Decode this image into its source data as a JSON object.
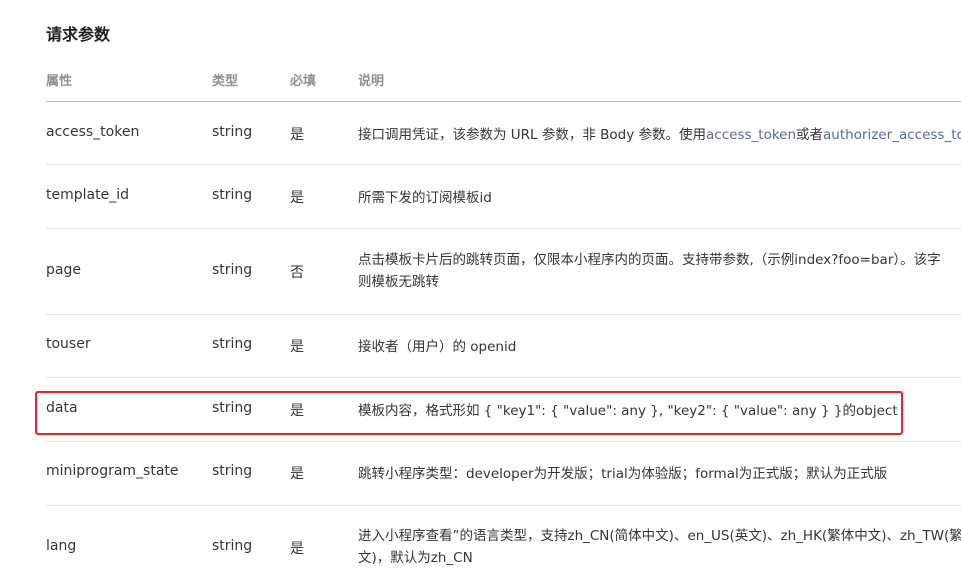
{
  "section_title": "请求参数",
  "table": {
    "headers": {
      "name": "属性",
      "type": "类型",
      "required": "必填",
      "desc": "说明"
    },
    "rows": [
      {
        "name": "access_token",
        "type": "string",
        "required": "是",
        "desc_parts": [
          "接口调用凭证，该参数为 URL 参数，非 Body 参数。使用",
          "access_token",
          "或者",
          "authorizer_access_to"
        ]
      },
      {
        "name": "template_id",
        "type": "string",
        "required": "是",
        "desc": "所需下发的订阅模板id"
      },
      {
        "name": "page",
        "type": "string",
        "required": "否",
        "desc_lines": [
          "点击模板卡片后的跳转页面，仅限本小程序内的页面。支持带参数,（示例index?foo=bar）。该字",
          "则模板无跳转"
        ]
      },
      {
        "name": "touser",
        "type": "string",
        "required": "是",
        "desc": "接收者（用户）的 openid"
      },
      {
        "name": "data",
        "type": "string",
        "required": "是",
        "desc": "模板内容，格式形如 { \"key1\": { \"value\": any }, \"key2\": { \"value\": any } }的object"
      },
      {
        "name": "miniprogram_state",
        "type": "string",
        "required": "是",
        "desc": "跳转小程序类型：developer为开发版；trial为体验版；formal为正式版；默认为正式版"
      },
      {
        "name": "lang",
        "type": "string",
        "required": "是",
        "desc_lines": [
          "进入小程序查看”的语言类型，支持zh_CN(简体中文)、en_US(英文)、zh_HK(繁体中文)、zh_TW(繁",
          "文)，默认为zh_CN"
        ]
      }
    ]
  },
  "highlight_color": "#e8242a"
}
